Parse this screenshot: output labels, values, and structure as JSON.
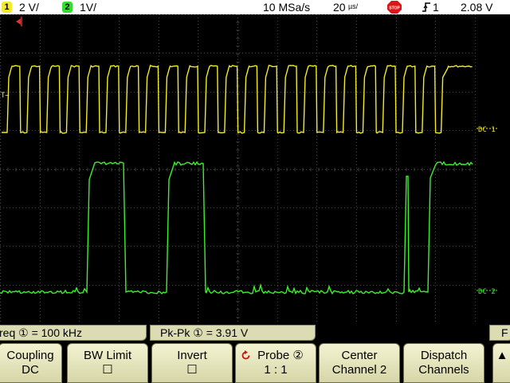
{
  "status_bar": {
    "ch1_number": "1",
    "ch1_scale": "2 V/",
    "ch2_number": "2",
    "ch2_scale": "1V/",
    "sample_rate": "10 MSa/s",
    "time_scale_value": "20",
    "time_scale_unit": "µs/",
    "run_state": "STOP",
    "trigger_icon": "rising-edge-trigger-icon",
    "trigger_source": "1",
    "trigger_level": "2.08  V"
  },
  "colors": {
    "ch1": "#f2ea2a",
    "ch2": "#3cf02e",
    "grid": "#4a4a4a",
    "trigger_marker": "#e03030",
    "stop_badge": "#d81818",
    "ch1_badge": "#f2ea2a",
    "ch2_badge": "#33dd33"
  },
  "markers": {
    "ch1_level": "T→",
    "ch1_ground": "DC 1",
    "ch2_ground": "DC 2"
  },
  "measurements": {
    "freq_label": "req",
    "freq_source": "①",
    "freq_value": "= 100 kHz",
    "pkpk_label": "Pk-Pk",
    "pkpk_source": "①",
    "pkpk_value": "=   3.91 V",
    "right_partial": "F"
  },
  "softkeys": [
    {
      "line1": "Coupling",
      "line2": "DC"
    },
    {
      "line1": "BW Limit",
      "line2": "☐"
    },
    {
      "line1": "Invert",
      "line2": "☐"
    },
    {
      "line1": "Probe ②",
      "line2": "1 : 1"
    },
    {
      "line1": "Center",
      "line2": "Channel 2"
    },
    {
      "line1": "Dispatch",
      "line2": "Channels"
    }
  ],
  "softkey_more": "▲"
}
